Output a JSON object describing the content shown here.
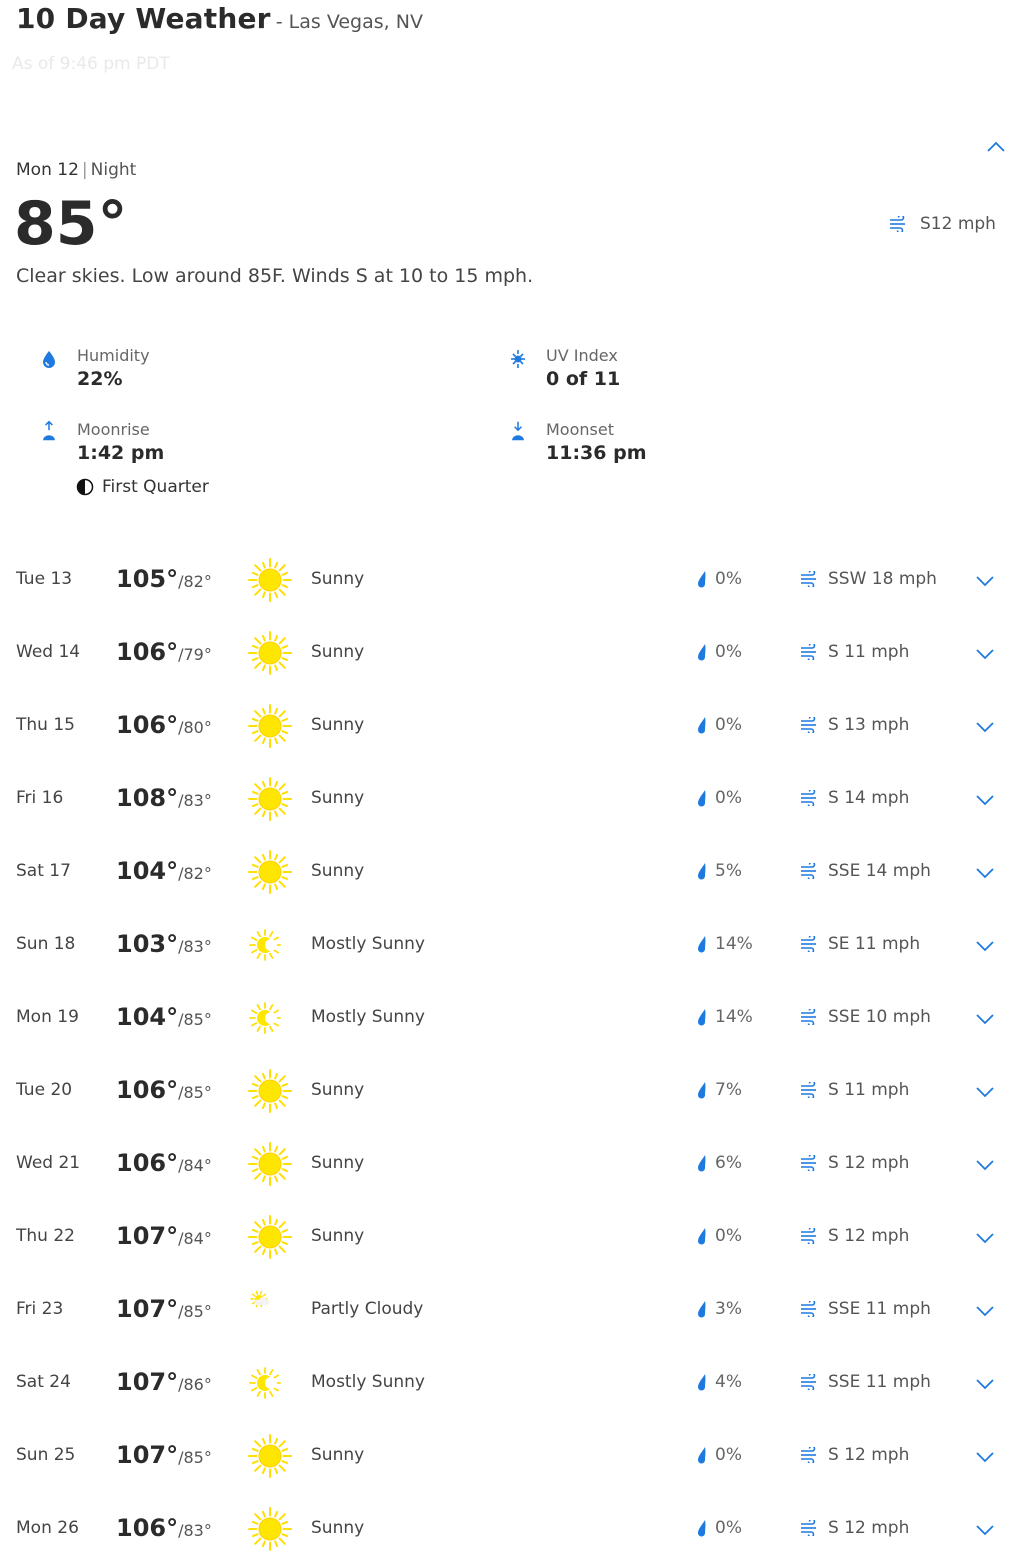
{
  "header": {
    "title": "10 Day Weather",
    "location": "- Las Vegas, NV",
    "as_of": "As of 9:46 pm PDT"
  },
  "current": {
    "day": "Mon 12",
    "separator": "|",
    "part": "Night",
    "temp": "85°",
    "wind": "S12 mph",
    "narrative": "Clear skies. Low around 85F. Winds S at 10 to 15 mph.",
    "details": {
      "humidity_label": "Humidity",
      "humidity_value": "22%",
      "uv_label": "UV Index",
      "uv_value": "0 of 11",
      "moonrise_label": "Moonrise",
      "moonrise_value": "1:42 pm",
      "moonset_label": "Moonset",
      "moonset_value": "11:36 pm",
      "moon_phase": "First Quarter"
    }
  },
  "colors": {
    "accent_blue": "#1f7ae0",
    "sun_yellow": "#ffe600",
    "text_dark": "#2b2b2b"
  },
  "days": [
    {
      "day": "Tue 13",
      "hi": "105°",
      "lo": "/82°",
      "icon": "sunny-icon",
      "cond": "Sunny",
      "precip": "0%",
      "wind": "SSW 18 mph"
    },
    {
      "day": "Wed 14",
      "hi": "106°",
      "lo": "/79°",
      "icon": "sunny-icon",
      "cond": "Sunny",
      "precip": "0%",
      "wind": "S 11 mph"
    },
    {
      "day": "Thu 15",
      "hi": "106°",
      "lo": "/80°",
      "icon": "sunny-icon",
      "cond": "Sunny",
      "precip": "0%",
      "wind": "S 13 mph"
    },
    {
      "day": "Fri 16",
      "hi": "108°",
      "lo": "/83°",
      "icon": "sunny-icon",
      "cond": "Sunny",
      "precip": "0%",
      "wind": "S 14 mph"
    },
    {
      "day": "Sat 17",
      "hi": "104°",
      "lo": "/82°",
      "icon": "sunny-icon",
      "cond": "Sunny",
      "precip": "5%",
      "wind": "SSE 14 mph"
    },
    {
      "day": "Sun 18",
      "hi": "103°",
      "lo": "/83°",
      "icon": "mostly-sunny-icon",
      "cond": "Mostly Sunny",
      "precip": "14%",
      "wind": "SE 11 mph"
    },
    {
      "day": "Mon 19",
      "hi": "104°",
      "lo": "/85°",
      "icon": "mostly-sunny-icon",
      "cond": "Mostly Sunny",
      "precip": "14%",
      "wind": "SSE 10 mph"
    },
    {
      "day": "Tue 20",
      "hi": "106°",
      "lo": "/85°",
      "icon": "sunny-icon",
      "cond": "Sunny",
      "precip": "7%",
      "wind": "S 11 mph"
    },
    {
      "day": "Wed 21",
      "hi": "106°",
      "lo": "/84°",
      "icon": "sunny-icon",
      "cond": "Sunny",
      "precip": "6%",
      "wind": "S 12 mph"
    },
    {
      "day": "Thu 22",
      "hi": "107°",
      "lo": "/84°",
      "icon": "sunny-icon",
      "cond": "Sunny",
      "precip": "0%",
      "wind": "S 12 mph"
    },
    {
      "day": "Fri 23",
      "hi": "107°",
      "lo": "/85°",
      "icon": "partly-cloudy-icon",
      "cond": "Partly Cloudy",
      "precip": "3%",
      "wind": "SSE 11 mph"
    },
    {
      "day": "Sat 24",
      "hi": "107°",
      "lo": "/86°",
      "icon": "mostly-sunny-icon",
      "cond": "Mostly Sunny",
      "precip": "4%",
      "wind": "SSE 11 mph"
    },
    {
      "day": "Sun 25",
      "hi": "107°",
      "lo": "/85°",
      "icon": "sunny-icon",
      "cond": "Sunny",
      "precip": "0%",
      "wind": "S 12 mph"
    },
    {
      "day": "Mon 26",
      "hi": "106°",
      "lo": "/83°",
      "icon": "sunny-icon",
      "cond": "Sunny",
      "precip": "0%",
      "wind": "S 12 mph"
    }
  ]
}
